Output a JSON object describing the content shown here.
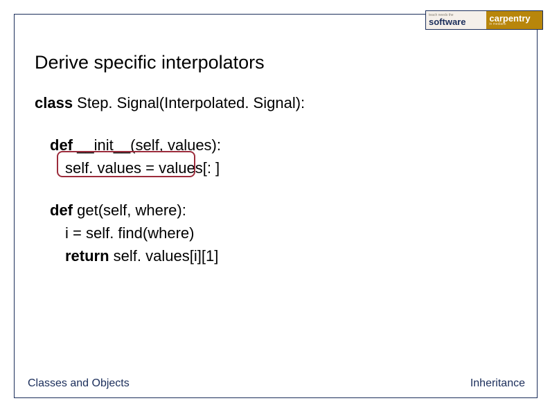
{
  "logo": {
    "left_tiny": "teach needs the",
    "left_big": "software",
    "right_big": "carpentry",
    "right_tiny": "in medians"
  },
  "slide": {
    "title": "Derive specific interpolators"
  },
  "code": {
    "line1_kw": "class",
    "line1_rest": " Step. Signal(Interpolated. Signal):",
    "line2_kw": "def",
    "line2_rest": " __init__(self, values):",
    "line3": "self. values = values[: ]",
    "line4_kw": "def",
    "line4_rest": " get(self, where):",
    "line5": "i = self. find(where)",
    "line6_kw": "return",
    "line6_rest": " self. values[i][1]"
  },
  "footer": {
    "left": "Classes and Objects",
    "right": "Inheritance"
  }
}
